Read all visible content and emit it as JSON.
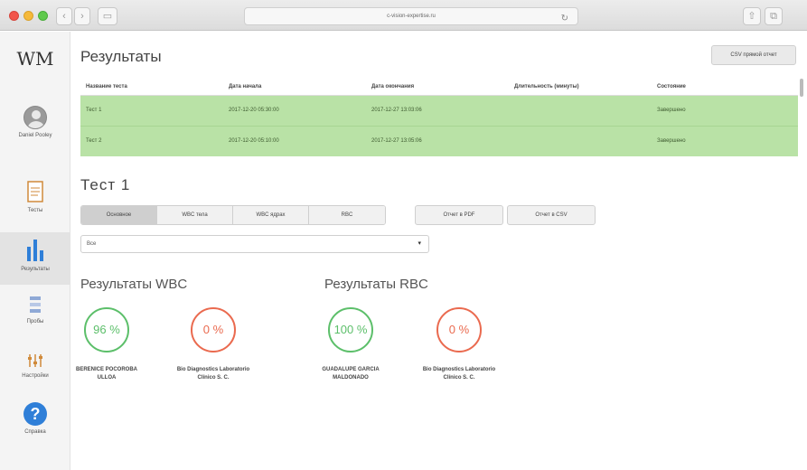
{
  "browser": {
    "url": "c-vision-expertise.ru"
  },
  "sidebar": {
    "logo": "WM",
    "user_name": "Daniel Pooley",
    "items": [
      {
        "label": "Тесты"
      },
      {
        "label": "Результаты"
      },
      {
        "label": "Пробы"
      },
      {
        "label": "Настройки"
      },
      {
        "label": "Справка"
      }
    ],
    "help_glyph": "?"
  },
  "main": {
    "title": "Результаты",
    "new_report_button": "CSV прямой отчет",
    "table": {
      "headers": [
        "Название теста",
        "Дата начала",
        "Дата окончания",
        "Длительность (минуты)",
        "Состояние"
      ],
      "rows": [
        [
          "Тест 1",
          "2017-12-20 05:30:00",
          "2017-12-27 13:03:06",
          "",
          "Завершено"
        ],
        [
          "Тест 2",
          "2017-12-20 05:10:00",
          "2017-12-27 13:05:06",
          "",
          "Завершено"
        ]
      ]
    },
    "test_title": "Тест 1",
    "tabs": [
      "Основное",
      "WBC тела",
      "WBC ядрах",
      "RBC"
    ],
    "export_pdf": "Отчет в PDF",
    "export_csv": "Отчет в CSV",
    "select_value": "Все",
    "wbc_title": "Результаты WBC",
    "rbc_title": "Результаты RBC",
    "gauges": [
      {
        "value": "96 %",
        "name": "BERENICE POCOROBA ULLOA",
        "status": "good"
      },
      {
        "value": "0 %",
        "name": "Bio Diagnostics Laboratorio Clínico S. C.",
        "status": "bad"
      },
      {
        "value": "100 %",
        "name": "GUADALUPE GARCIA MALDONADO",
        "status": "good"
      },
      {
        "value": "0 %",
        "name": "Bio Diagnostics Laboratorio Clínico S. C.",
        "status": "bad"
      }
    ]
  },
  "colors": {
    "row_green": "#b9e2a6",
    "good": "#5cbf6a",
    "bad": "#ea6a4f",
    "help_blue": "#2f7fd8"
  }
}
